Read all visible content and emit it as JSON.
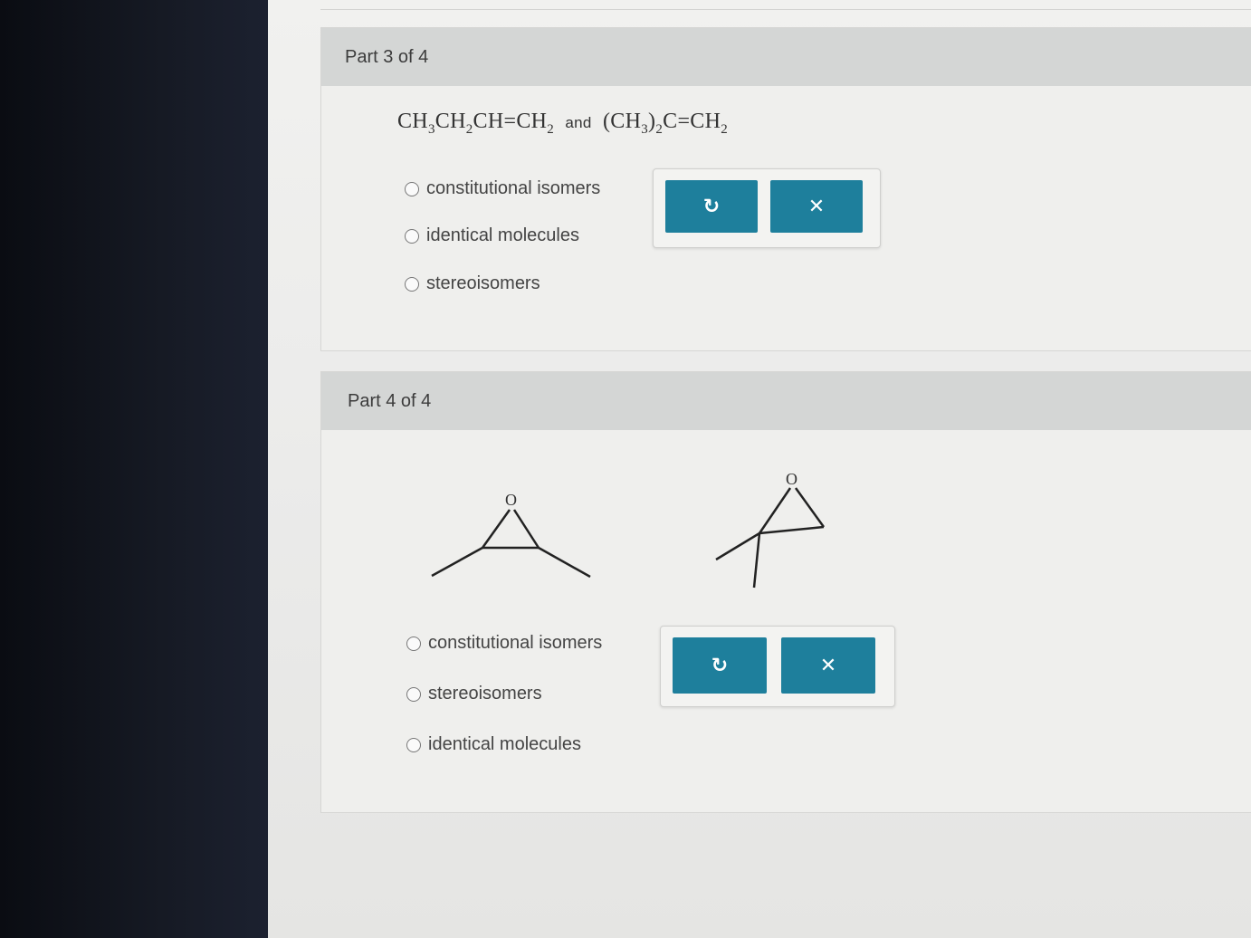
{
  "part3": {
    "title": "Part 3 of 4",
    "formula": {
      "left": [
        "CH",
        "3",
        "CH",
        "2",
        "CH",
        "=",
        "CH",
        "2"
      ],
      "and": "and",
      "right_paren_open": "(CH",
      "right_sub1": "3",
      "right_paren_close": ")",
      "right_sub2": "2",
      "right_rest": "C",
      "right_eq": "=",
      "right_ch": "CH",
      "right_sub3": "2"
    },
    "options": [
      "constitutional isomers",
      "identical molecules",
      "stereoisomers"
    ],
    "buttons": {
      "reset_icon": "↻",
      "clear_icon": "✕"
    }
  },
  "part4": {
    "title": "Part 4 of 4",
    "molecule_atom_label": "O",
    "options": [
      "constitutional isomers",
      "stereoisomers",
      "identical molecules"
    ],
    "buttons": {
      "reset_icon": "↻",
      "clear_icon": "✕"
    }
  },
  "colors": {
    "accent": "#1e7f9c",
    "header_bg": "#d4d6d5"
  },
  "icons": {
    "reset": "undo-icon",
    "clear": "close-icon",
    "radio": "radio-icon"
  }
}
